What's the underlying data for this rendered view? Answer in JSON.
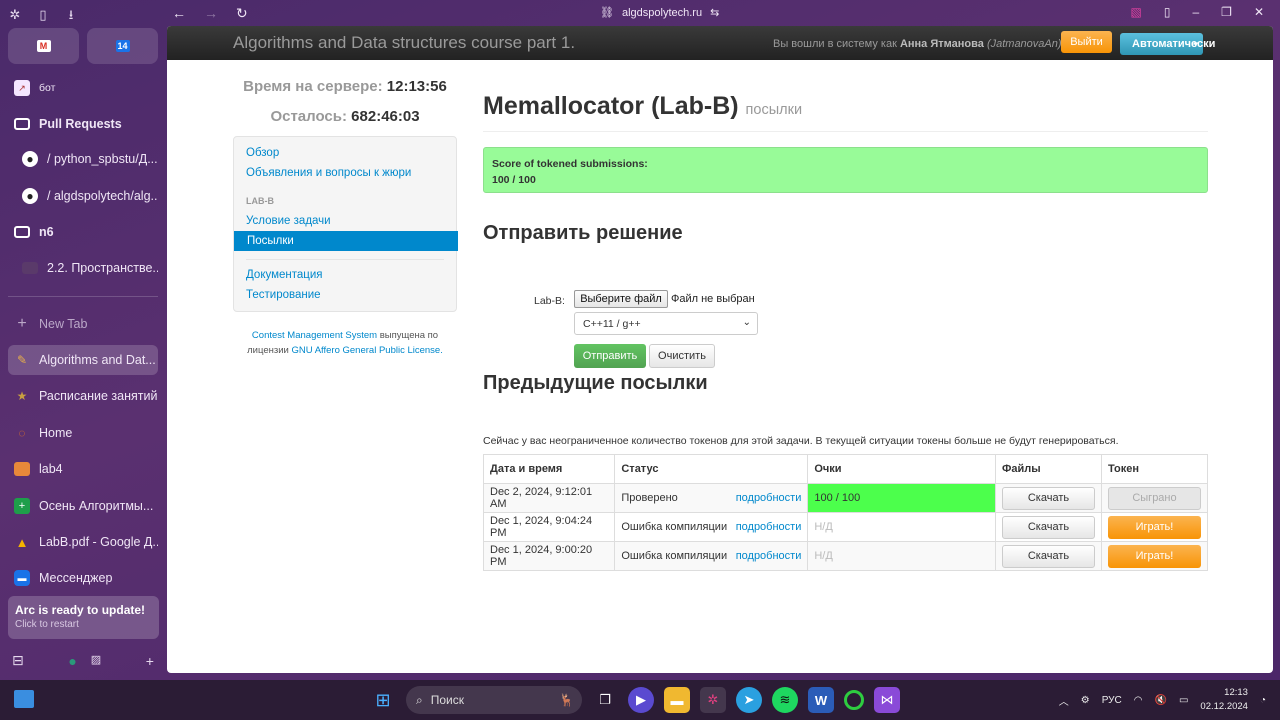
{
  "browser": {
    "url": "algdspolytech.ru",
    "sidebar": {
      "items": [
        {
          "label": "бот",
          "kind": "small",
          "icon": "chart-icon"
        },
        {
          "label": "Pull Requests",
          "kind": "folder",
          "icon": "folder-icon"
        },
        {
          "label": "/ python_spbstu/Д...",
          "kind": "tab",
          "icon": "github-icon"
        },
        {
          "label": "/ algdspolytech/alg...",
          "kind": "tab",
          "icon": "github-icon"
        },
        {
          "label": "n6",
          "kind": "folder",
          "icon": "folder-icon"
        },
        {
          "label": "2.2. Пространстве...",
          "kind": "tab",
          "icon": "page-icon"
        },
        {
          "label": "New Tab",
          "kind": "newtab",
          "icon": "plus-icon"
        },
        {
          "label": "Algorithms and Dat...",
          "kind": "tab",
          "icon": "pen-icon",
          "active": true
        },
        {
          "label": "Расписание занятий",
          "kind": "tab",
          "icon": "star-icon"
        },
        {
          "label": "Home",
          "kind": "tab",
          "icon": "orbit-icon"
        },
        {
          "label": "lab4",
          "kind": "tab",
          "icon": "book-icon"
        },
        {
          "label": "Осень Алгоритмы...",
          "kind": "tab",
          "icon": "sheets-icon"
        },
        {
          "label": "LabB.pdf - Google Д...",
          "kind": "tab",
          "icon": "drive-icon"
        },
        {
          "label": "Мессенджер",
          "kind": "tab",
          "icon": "chat-icon"
        }
      ],
      "update_title": "Arc is ready to update!",
      "update_sub": "Click to restart"
    }
  },
  "site": {
    "brand": "Algorithms and Data structures course part 1.",
    "login_prefix": "Вы вошли в систему как",
    "login_name": "Анна Ятманова",
    "login_user": "(JatmanovaAn)",
    "logout": "Выйти",
    "auto": "Автоматически"
  },
  "sidebar": {
    "server_time_label": "Время на сервере:",
    "server_time": "12:13:56",
    "remaining_label": "Осталось:",
    "remaining": "682:46:03",
    "links": {
      "overview": "Обзор",
      "announcements": "Объявления и вопросы к жюри",
      "section": "LAB-B",
      "statement": "Условие задачи",
      "submissions": "Посылки",
      "docs": "Документация",
      "testing": "Тестирование"
    },
    "license_link": "Contest Management System",
    "license_mid": "выпущена по лицензии",
    "license_name": "GNU Affero General Public License."
  },
  "main": {
    "title": "Memallocator (Lab-B)",
    "title_sub": "посылки",
    "score_label": "Score of tokened submissions:",
    "score_value": "100 / 100",
    "submit_heading": "Отправить решение",
    "file_label": "Lab-B:",
    "file_button": "Выберите файл",
    "file_status": "Файл не выбран",
    "language": "C++11 / g++",
    "send": "Отправить",
    "clear": "Очистить",
    "prev_heading": "Предыдущие посылки",
    "tokens_note": "Сейчас у вас неограниченное количество токенов для этой задачи. В текущей ситуации токены больше не будут генерироваться.",
    "columns": [
      "Дата и время",
      "Статус",
      "Очки",
      "Файлы",
      "Токен"
    ],
    "rows": [
      {
        "date": "Dec 2, 2024, 9:12:01 AM",
        "status": "Проверено",
        "details": "подробности",
        "score": "100 / 100",
        "files": "Скачать",
        "token": "Сыграно"
      },
      {
        "date": "Dec 1, 2024, 9:04:24 PM",
        "status": "Ошибка компиляции",
        "details": "подробности",
        "score": "Н/Д",
        "files": "Скачать",
        "token": "Играть!"
      },
      {
        "date": "Dec 1, 2024, 9:00:20 PM",
        "status": "Ошибка компиляции",
        "details": "подробности",
        "score": "Н/Д",
        "files": "Скачать",
        "token": "Играть!"
      }
    ]
  },
  "taskbar": {
    "search": "Поиск",
    "lang": "РУС",
    "time": "12:13",
    "date": "02.12.2024"
  }
}
